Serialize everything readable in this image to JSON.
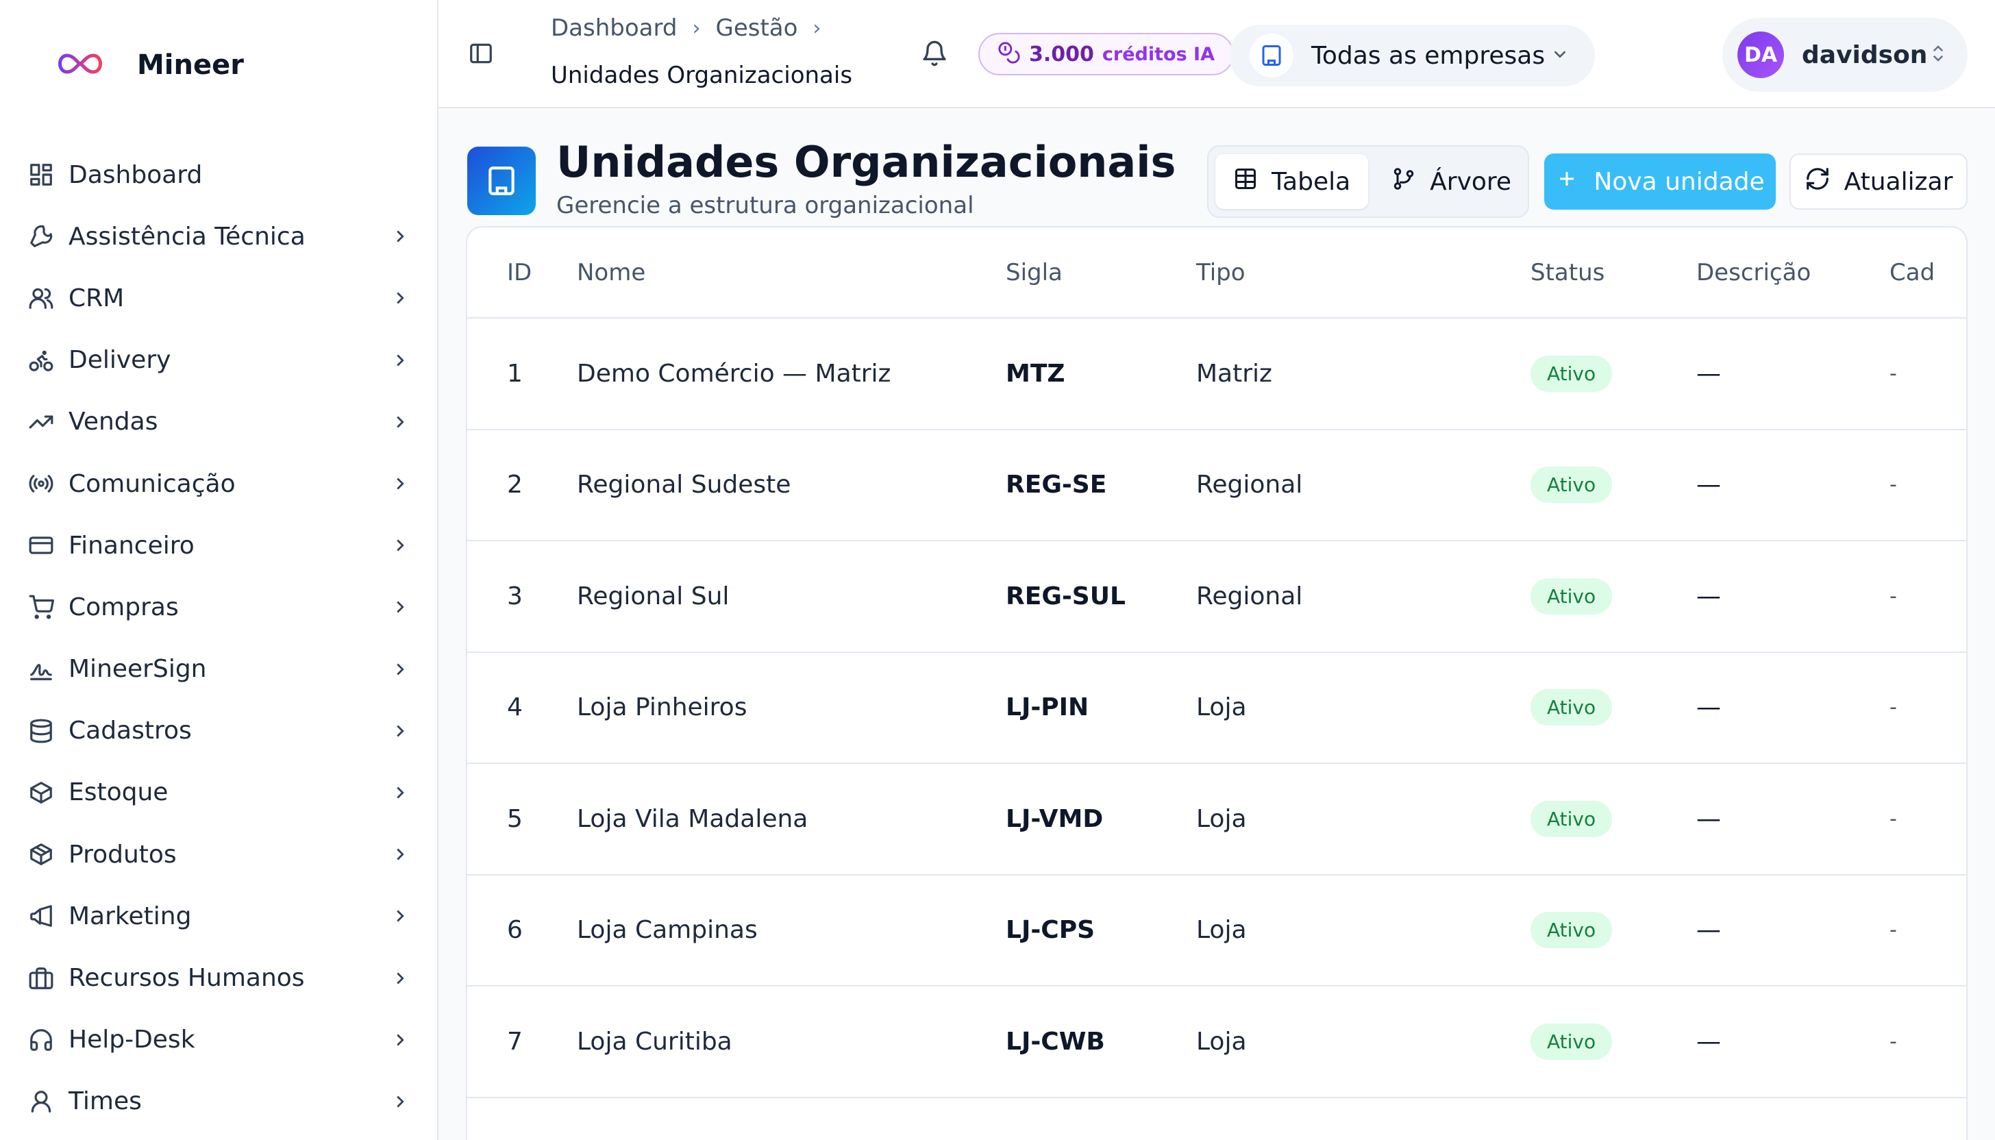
{
  "brand": {
    "name": "Mineer"
  },
  "sidebar": {
    "items": [
      {
        "label": "Dashboard",
        "icon": "dashboard-icon",
        "has_children": false
      },
      {
        "label": "Assistência Técnica",
        "icon": "wrench-icon",
        "has_children": true
      },
      {
        "label": "CRM",
        "icon": "users-icon",
        "has_children": true
      },
      {
        "label": "Delivery",
        "icon": "bike-icon",
        "has_children": true
      },
      {
        "label": "Vendas",
        "icon": "trending-up-icon",
        "has_children": true
      },
      {
        "label": "Comunicação",
        "icon": "radio-icon",
        "has_children": true
      },
      {
        "label": "Financeiro",
        "icon": "credit-card-icon",
        "has_children": true
      },
      {
        "label": "Compras",
        "icon": "cart-icon",
        "has_children": true
      },
      {
        "label": "MineerSign",
        "icon": "signature-icon",
        "has_children": true
      },
      {
        "label": "Cadastros",
        "icon": "database-icon",
        "has_children": true
      },
      {
        "label": "Estoque",
        "icon": "package-icon",
        "has_children": true
      },
      {
        "label": "Produtos",
        "icon": "box-icon",
        "has_children": true
      },
      {
        "label": "Marketing",
        "icon": "megaphone-icon",
        "has_children": true
      },
      {
        "label": "Recursos Humanos",
        "icon": "briefcase-icon",
        "has_children": true
      },
      {
        "label": "Help-Desk",
        "icon": "headphones-icon",
        "has_children": true
      },
      {
        "label": "Times",
        "icon": "team-icon",
        "has_children": true
      }
    ]
  },
  "header": {
    "breadcrumb": [
      "Dashboard",
      "Gestão",
      "Unidades Organizacionais"
    ],
    "credits": {
      "value": "3.000",
      "unit": "créditos IA"
    },
    "company_selector": "Todas as empresas",
    "user": {
      "initials": "DA",
      "name": "davidson"
    }
  },
  "page": {
    "title": "Unidades Organizacionais",
    "subtitle": "Gerencie a estrutura organizacional",
    "view_table": "Tabela",
    "view_tree": "Árvore",
    "new_button": "Nova unidade",
    "refresh_button": "Atualizar"
  },
  "table": {
    "columns": [
      "ID",
      "Nome",
      "Sigla",
      "Tipo",
      "Status",
      "Descrição",
      "Cad"
    ],
    "rows": [
      {
        "id": "1",
        "nome": "Demo Comércio — Matriz",
        "sigla": "MTZ",
        "tipo": "Matriz",
        "status": "Ativo",
        "descricao": "—",
        "cad": "-"
      },
      {
        "id": "2",
        "nome": "Regional Sudeste",
        "sigla": "REG-SE",
        "tipo": "Regional",
        "status": "Ativo",
        "descricao": "—",
        "cad": "-"
      },
      {
        "id": "3",
        "nome": "Regional Sul",
        "sigla": "REG-SUL",
        "tipo": "Regional",
        "status": "Ativo",
        "descricao": "—",
        "cad": "-"
      },
      {
        "id": "4",
        "nome": "Loja Pinheiros",
        "sigla": "LJ-PIN",
        "tipo": "Loja",
        "status": "Ativo",
        "descricao": "—",
        "cad": "-"
      },
      {
        "id": "5",
        "nome": "Loja Vila Madalena",
        "sigla": "LJ-VMD",
        "tipo": "Loja",
        "status": "Ativo",
        "descricao": "—",
        "cad": "-"
      },
      {
        "id": "6",
        "nome": "Loja Campinas",
        "sigla": "LJ-CPS",
        "tipo": "Loja",
        "status": "Ativo",
        "descricao": "—",
        "cad": "-"
      },
      {
        "id": "7",
        "nome": "Loja Curitiba",
        "sigla": "LJ-CWB",
        "tipo": "Loja",
        "status": "Ativo",
        "descricao": "—",
        "cad": "-"
      }
    ]
  },
  "colors": {
    "accent": "#38bdf8",
    "status_active_bg": "#dcfce7",
    "status_active_text": "#15803d",
    "credits": "#6b21a8"
  }
}
